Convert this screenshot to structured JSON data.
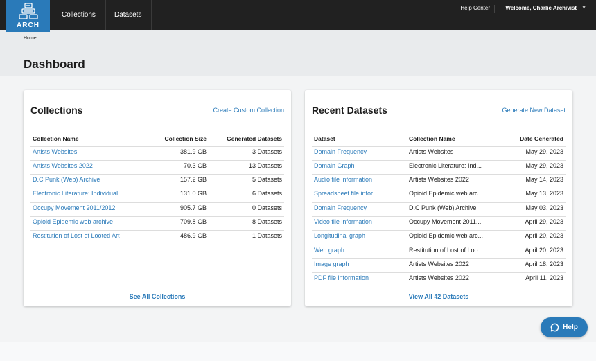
{
  "brand": {
    "logo_text": "ARCH",
    "accent": "#2a7ab9"
  },
  "nav": {
    "items": [
      {
        "label": "Collections"
      },
      {
        "label": "Datasets"
      }
    ],
    "help_center": "Help Center",
    "welcome": "Welcome, Charlie Archivist"
  },
  "breadcrumb": "Home",
  "page_title": "Dashboard",
  "collections": {
    "title": "Collections",
    "action": "Create Custom Collection",
    "headers": [
      "Collection Name",
      "Collection Size",
      "Generated Datasets"
    ],
    "rows": [
      {
        "name": "Artists Websites",
        "size": "381.9 GB",
        "datasets": "3 Datasets"
      },
      {
        "name": "Artists Websites 2022",
        "size": "70.3 GB",
        "datasets": "13 Datasets"
      },
      {
        "name": "D.C Punk (Web) Archive",
        "size": "157.2 GB",
        "datasets": "5 Datasets"
      },
      {
        "name": "Electronic Literature: Individual...",
        "size": "131.0 GB",
        "datasets": "6 Datasets"
      },
      {
        "name": "Occupy Movement 2011/2012",
        "size": "905.7 GB",
        "datasets": "0 Datasets"
      },
      {
        "name": "Opioid Epidemic web archive",
        "size": "709.8 GB",
        "datasets": "8 Datasets"
      },
      {
        "name": "Restitution of Lost of Looted Art",
        "size": "486.9 GB",
        "datasets": "1 Datasets"
      }
    ],
    "footer": "See All Collections"
  },
  "recent": {
    "title": "Recent Datasets",
    "action": "Generate New Dataset",
    "headers": [
      "Dataset",
      "Collection Name",
      "Date Generated"
    ],
    "rows": [
      {
        "dataset": "Domain Frequency",
        "collection": "Artists Websites",
        "date": "May 29, 2023"
      },
      {
        "dataset": "Domain Graph",
        "collection": "Electronic Literature: Ind...",
        "date": "May 29, 2023"
      },
      {
        "dataset": "Audio file information",
        "collection": "Artists Websites 2022",
        "date": "May 14, 2023"
      },
      {
        "dataset": "Spreadsheet file infor...",
        "collection": "Opioid Epidemic web arc...",
        "date": "May 13, 2023"
      },
      {
        "dataset": "Domain Frequency",
        "collection": "D.C Punk (Web) Archive",
        "date": "May 03, 2023"
      },
      {
        "dataset": "Video file information",
        "collection": "Occupy Movement 2011...",
        "date": "April 29, 2023"
      },
      {
        "dataset": "Longitudinal graph",
        "collection": "Opioid Epidemic web arc...",
        "date": "April 20, 2023"
      },
      {
        "dataset": "Web graph",
        "collection": "Restitution of Lost of Loo...",
        "date": "April 20, 2023"
      },
      {
        "dataset": "Image graph",
        "collection": "Artists Websites 2022",
        "date": "April 18, 2023"
      },
      {
        "dataset": "PDF file information",
        "collection": "Artists Websites 2022",
        "date": "April 11, 2023"
      }
    ],
    "footer": "View All 42 Datasets"
  },
  "help_button": {
    "label": "Help",
    "icon": "chat-bubble-icon"
  }
}
